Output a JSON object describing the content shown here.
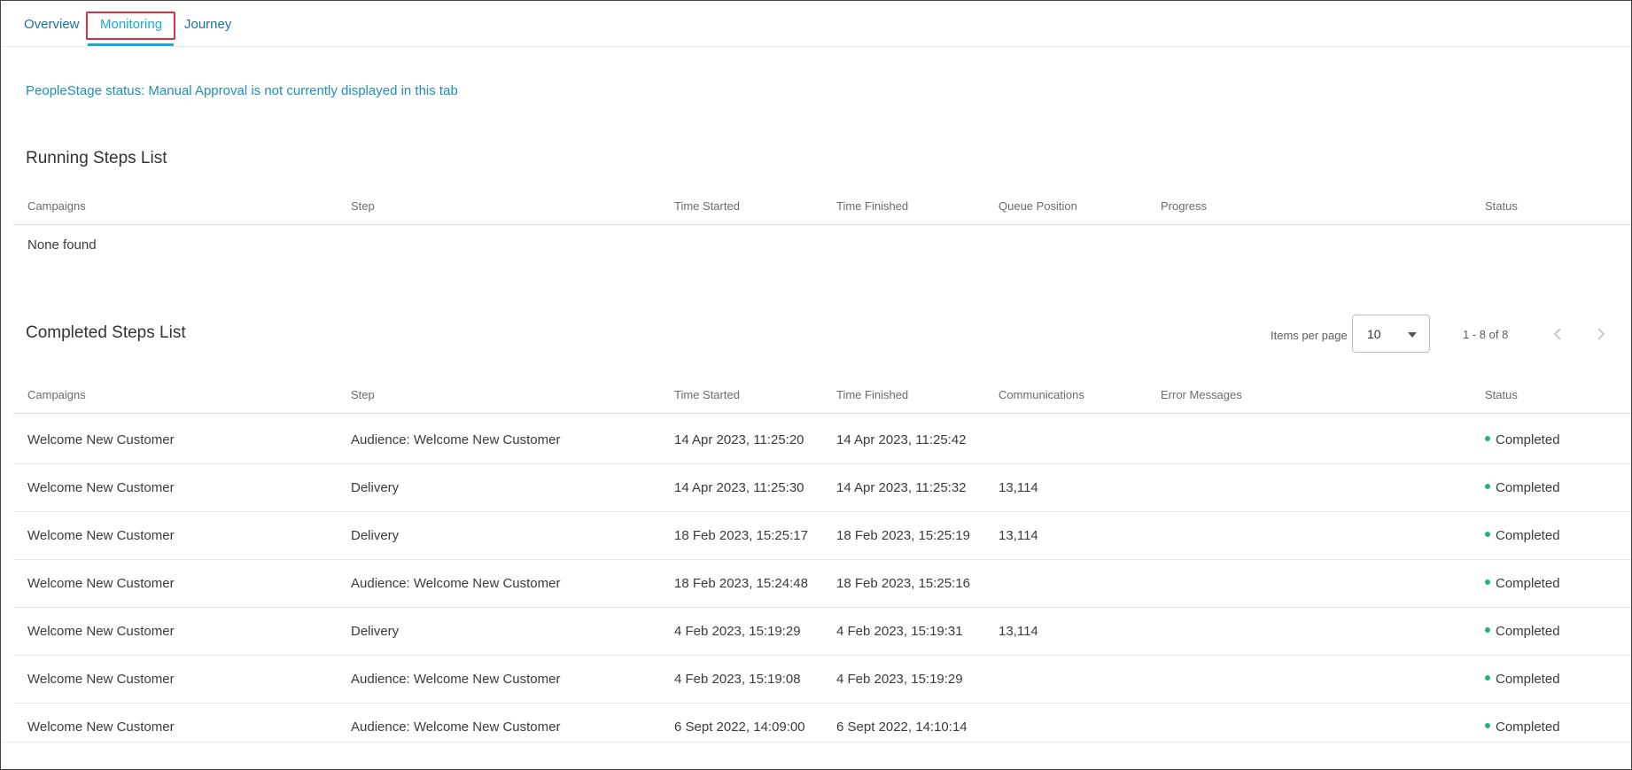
{
  "tabs": [
    {
      "label": "Overview"
    },
    {
      "label": "Monitoring"
    },
    {
      "label": "Journey"
    }
  ],
  "notice": "PeopleStage status: Manual Approval is not currently displayed in this tab",
  "running": {
    "title": "Running Steps List",
    "columns": [
      "Campaigns",
      "Step",
      "Time Started",
      "Time Finished",
      "Queue Position",
      "Progress",
      "Status"
    ],
    "empty_text": "None found"
  },
  "completed": {
    "title": "Completed Steps List",
    "pagination": {
      "items_per_page_label": "Items per page",
      "items_per_page": "10",
      "range": "1 - 8 of 8"
    },
    "columns": [
      "Campaigns",
      "Step",
      "Time Started",
      "Time Finished",
      "Communications",
      "Error Messages",
      "Status"
    ],
    "rows": [
      {
        "campaign": "Welcome New Customer",
        "step": "Audience: Welcome New Customer",
        "started": "14 Apr 2023, 11:25:20",
        "finished": "14 Apr 2023, 11:25:42",
        "communications": "",
        "errors": "",
        "status": "Completed"
      },
      {
        "campaign": "Welcome New Customer",
        "step": "Delivery",
        "started": "14 Apr 2023, 11:25:30",
        "finished": "14 Apr 2023, 11:25:32",
        "communications": "13,114",
        "errors": "",
        "status": "Completed"
      },
      {
        "campaign": "Welcome New Customer",
        "step": "Delivery",
        "started": "18 Feb 2023, 15:25:17",
        "finished": "18 Feb 2023, 15:25:19",
        "communications": "13,114",
        "errors": "",
        "status": "Completed"
      },
      {
        "campaign": "Welcome New Customer",
        "step": "Audience: Welcome New Customer",
        "started": "18 Feb 2023, 15:24:48",
        "finished": "18 Feb 2023, 15:25:16",
        "communications": "",
        "errors": "",
        "status": "Completed"
      },
      {
        "campaign": "Welcome New Customer",
        "step": "Delivery",
        "started": "4 Feb 2023, 15:19:29",
        "finished": "4 Feb 2023, 15:19:31",
        "communications": "13,114",
        "errors": "",
        "status": "Completed"
      },
      {
        "campaign": "Welcome New Customer",
        "step": "Audience: Welcome New Customer",
        "started": "4 Feb 2023, 15:19:08",
        "finished": "4 Feb 2023, 15:19:29",
        "communications": "",
        "errors": "",
        "status": "Completed"
      },
      {
        "campaign": "Welcome New Customer",
        "step": "Audience: Welcome New Customer",
        "started": "6 Sept 2022, 14:09:00",
        "finished": "6 Sept 2022, 14:10:14",
        "communications": "",
        "errors": "",
        "status": "Completed"
      }
    ]
  },
  "colors": {
    "accent": "#1aa9d6",
    "link": "#1d6f9e",
    "highlight_box": "#d9333f",
    "status_completed": "#21b573"
  },
  "icons": {
    "prev": "chevron-left-icon",
    "next": "chevron-right-icon",
    "dropdown": "caret-down-icon",
    "status": "status-dot-icon"
  }
}
